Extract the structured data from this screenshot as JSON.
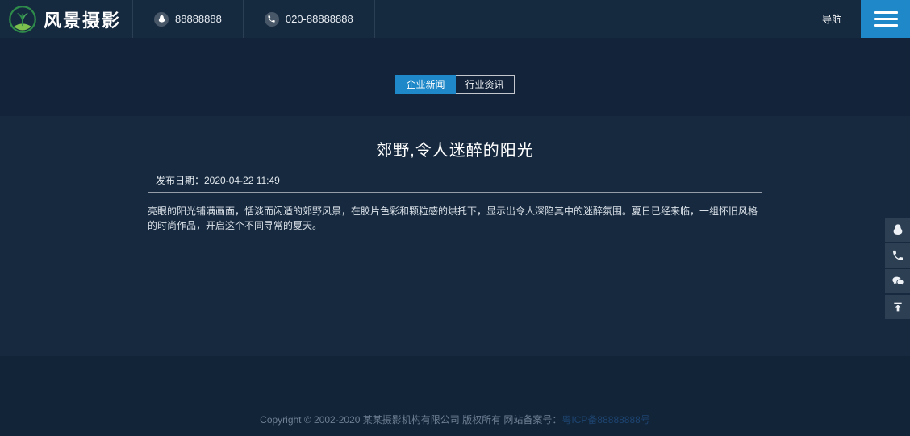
{
  "theme": {
    "header_bg": "#15293f",
    "band_bg": "#12233a",
    "content_bg": "#16293e",
    "footer_bg": "#122438",
    "accent_blue": "#1e88c8",
    "side_button_bg": "#2d3f53"
  },
  "header": {
    "logo_text": "风景摄影",
    "nav_label": "导航",
    "contacts": [
      {
        "icon": "qq-icon",
        "number": "88888888"
      },
      {
        "icon": "phone-icon",
        "number": "020-88888888"
      }
    ]
  },
  "tabs": [
    {
      "label": "企业新闻",
      "active": true
    },
    {
      "label": "行业资讯",
      "active": false
    }
  ],
  "article": {
    "title": "郊野,令人迷醉的阳光",
    "date": "发布日期：2020-04-22 11:49",
    "body": "亮眼的阳光铺满画面，恬淡而闲适的郊野风景，在胶片色彩和颗粒感的烘托下，显示出令人深陷其中的迷醉氛围。夏日已经来临，一组怀旧风格的时尚作品，开启这个不同寻常的夏天。"
  },
  "floating_buttons": [
    "qq",
    "phone",
    "wechat",
    "back-to-top"
  ],
  "footer": {
    "copyright": "Copyright © 2002-2020 某某摄影机构有限公司 版权所有 网站备案号：",
    "icp": "粤ICP备88888888号"
  }
}
